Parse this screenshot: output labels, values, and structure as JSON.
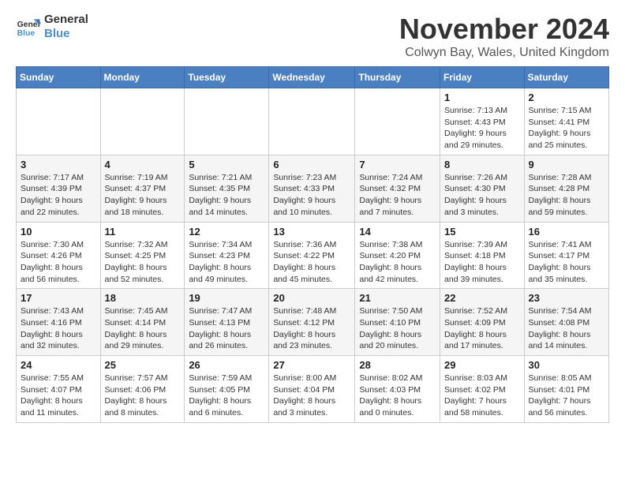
{
  "logo": {
    "line1": "General",
    "line2": "Blue"
  },
  "title": "November 2024",
  "location": "Colwyn Bay, Wales, United Kingdom",
  "weekdays": [
    "Sunday",
    "Monday",
    "Tuesday",
    "Wednesday",
    "Thursday",
    "Friday",
    "Saturday"
  ],
  "weeks": [
    [
      {
        "day": "",
        "info": ""
      },
      {
        "day": "",
        "info": ""
      },
      {
        "day": "",
        "info": ""
      },
      {
        "day": "",
        "info": ""
      },
      {
        "day": "",
        "info": ""
      },
      {
        "day": "1",
        "info": "Sunrise: 7:13 AM\nSunset: 4:43 PM\nDaylight: 9 hours\nand 29 minutes."
      },
      {
        "day": "2",
        "info": "Sunrise: 7:15 AM\nSunset: 4:41 PM\nDaylight: 9 hours\nand 25 minutes."
      }
    ],
    [
      {
        "day": "3",
        "info": "Sunrise: 7:17 AM\nSunset: 4:39 PM\nDaylight: 9 hours\nand 22 minutes."
      },
      {
        "day": "4",
        "info": "Sunrise: 7:19 AM\nSunset: 4:37 PM\nDaylight: 9 hours\nand 18 minutes."
      },
      {
        "day": "5",
        "info": "Sunrise: 7:21 AM\nSunset: 4:35 PM\nDaylight: 9 hours\nand 14 minutes."
      },
      {
        "day": "6",
        "info": "Sunrise: 7:23 AM\nSunset: 4:33 PM\nDaylight: 9 hours\nand 10 minutes."
      },
      {
        "day": "7",
        "info": "Sunrise: 7:24 AM\nSunset: 4:32 PM\nDaylight: 9 hours\nand 7 minutes."
      },
      {
        "day": "8",
        "info": "Sunrise: 7:26 AM\nSunset: 4:30 PM\nDaylight: 9 hours\nand 3 minutes."
      },
      {
        "day": "9",
        "info": "Sunrise: 7:28 AM\nSunset: 4:28 PM\nDaylight: 8 hours\nand 59 minutes."
      }
    ],
    [
      {
        "day": "10",
        "info": "Sunrise: 7:30 AM\nSunset: 4:26 PM\nDaylight: 8 hours\nand 56 minutes."
      },
      {
        "day": "11",
        "info": "Sunrise: 7:32 AM\nSunset: 4:25 PM\nDaylight: 8 hours\nand 52 minutes."
      },
      {
        "day": "12",
        "info": "Sunrise: 7:34 AM\nSunset: 4:23 PM\nDaylight: 8 hours\nand 49 minutes."
      },
      {
        "day": "13",
        "info": "Sunrise: 7:36 AM\nSunset: 4:22 PM\nDaylight: 8 hours\nand 45 minutes."
      },
      {
        "day": "14",
        "info": "Sunrise: 7:38 AM\nSunset: 4:20 PM\nDaylight: 8 hours\nand 42 minutes."
      },
      {
        "day": "15",
        "info": "Sunrise: 7:39 AM\nSunset: 4:18 PM\nDaylight: 8 hours\nand 39 minutes."
      },
      {
        "day": "16",
        "info": "Sunrise: 7:41 AM\nSunset: 4:17 PM\nDaylight: 8 hours\nand 35 minutes."
      }
    ],
    [
      {
        "day": "17",
        "info": "Sunrise: 7:43 AM\nSunset: 4:16 PM\nDaylight: 8 hours\nand 32 minutes."
      },
      {
        "day": "18",
        "info": "Sunrise: 7:45 AM\nSunset: 4:14 PM\nDaylight: 8 hours\nand 29 minutes."
      },
      {
        "day": "19",
        "info": "Sunrise: 7:47 AM\nSunset: 4:13 PM\nDaylight: 8 hours\nand 26 minutes."
      },
      {
        "day": "20",
        "info": "Sunrise: 7:48 AM\nSunset: 4:12 PM\nDaylight: 8 hours\nand 23 minutes."
      },
      {
        "day": "21",
        "info": "Sunrise: 7:50 AM\nSunset: 4:10 PM\nDaylight: 8 hours\nand 20 minutes."
      },
      {
        "day": "22",
        "info": "Sunrise: 7:52 AM\nSunset: 4:09 PM\nDaylight: 8 hours\nand 17 minutes."
      },
      {
        "day": "23",
        "info": "Sunrise: 7:54 AM\nSunset: 4:08 PM\nDaylight: 8 hours\nand 14 minutes."
      }
    ],
    [
      {
        "day": "24",
        "info": "Sunrise: 7:55 AM\nSunset: 4:07 PM\nDaylight: 8 hours\nand 11 minutes."
      },
      {
        "day": "25",
        "info": "Sunrise: 7:57 AM\nSunset: 4:06 PM\nDaylight: 8 hours\nand 8 minutes."
      },
      {
        "day": "26",
        "info": "Sunrise: 7:59 AM\nSunset: 4:05 PM\nDaylight: 8 hours\nand 6 minutes."
      },
      {
        "day": "27",
        "info": "Sunrise: 8:00 AM\nSunset: 4:04 PM\nDaylight: 8 hours\nand 3 minutes."
      },
      {
        "day": "28",
        "info": "Sunrise: 8:02 AM\nSunset: 4:03 PM\nDaylight: 8 hours\nand 0 minutes."
      },
      {
        "day": "29",
        "info": "Sunrise: 8:03 AM\nSunset: 4:02 PM\nDaylight: 7 hours\nand 58 minutes."
      },
      {
        "day": "30",
        "info": "Sunrise: 8:05 AM\nSunset: 4:01 PM\nDaylight: 7 hours\nand 56 minutes."
      }
    ]
  ]
}
